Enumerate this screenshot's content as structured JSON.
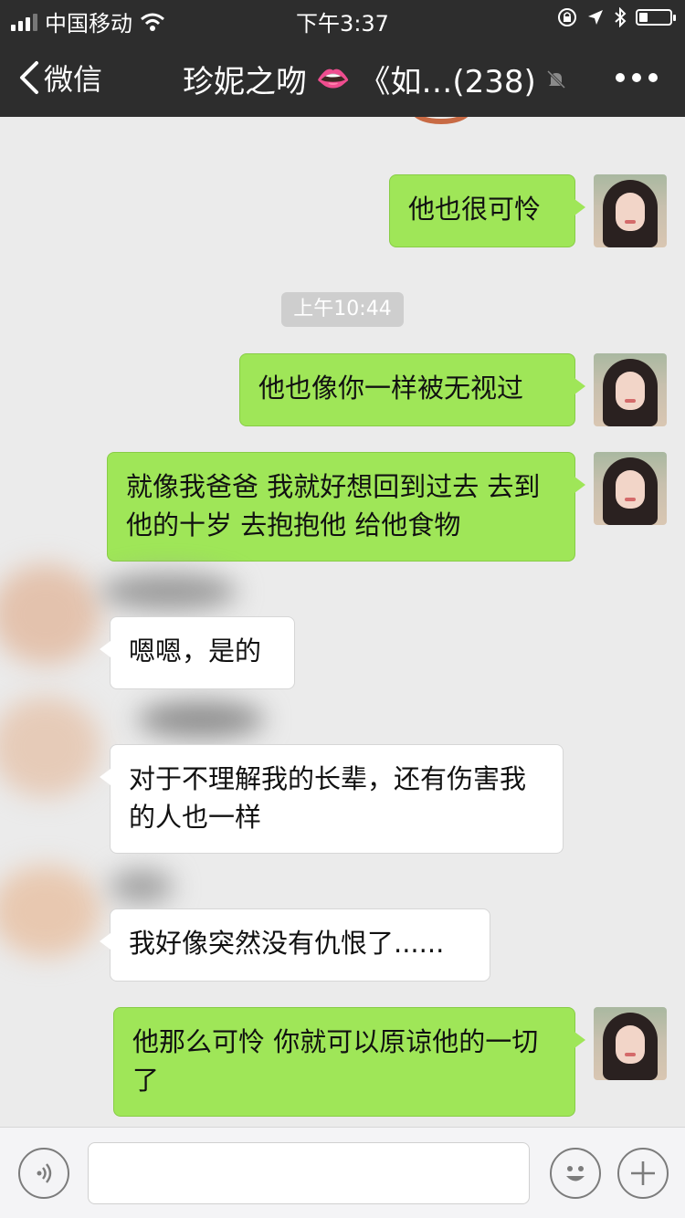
{
  "status_bar": {
    "carrier": "中国移动",
    "time": "下午3:37"
  },
  "nav": {
    "back_label": "微信",
    "title_main": "珍妮之吻",
    "title_tail": "《如…(238)",
    "lips_emoji": "👄"
  },
  "chat": {
    "timestamp": "上午10:44",
    "messages": [
      {
        "side": "me",
        "text": "他也很可怜"
      },
      {
        "side": "me",
        "text": "他也像你一样被无视过"
      },
      {
        "side": "me",
        "text": "就像我爸爸 我就好想回到过去 去到他的十岁 去抱抱他 给他食物"
      },
      {
        "side": "other",
        "text": "嗯嗯，是的"
      },
      {
        "side": "other",
        "text": "对于不理解我的长辈，还有伤害我的人也一样"
      },
      {
        "side": "other",
        "text": "我好像突然没有仇恨了......"
      },
      {
        "side": "me",
        "text": "他那么可怜 你就可以原谅他的一切了"
      }
    ]
  },
  "input_bar": {
    "text": ""
  },
  "colors": {
    "bar_bg": "#2d2d2d",
    "chat_bg": "#ebebeb",
    "my_bubble": "#9fe658",
    "other_bubble": "#ffffff"
  },
  "icons": [
    "signal-icon",
    "wifi-icon",
    "lock-rotation-icon",
    "location-icon",
    "bluetooth-icon",
    "battery-icon",
    "back-chevron-icon",
    "mute-bell-icon",
    "more-icon",
    "voice-icon",
    "emoji-icon",
    "plus-icon"
  ]
}
